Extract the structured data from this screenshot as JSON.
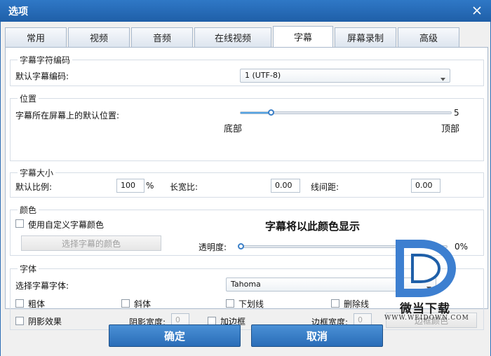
{
  "window": {
    "title": "选项"
  },
  "tabs": [
    {
      "label": "常用"
    },
    {
      "label": "视频"
    },
    {
      "label": "音频"
    },
    {
      "label": "在线视频"
    },
    {
      "label": "字幕"
    },
    {
      "label": "屏幕录制"
    },
    {
      "label": "高级"
    }
  ],
  "active_tab": "字幕",
  "encoding": {
    "title": "字幕字符编码",
    "default_label": "默认字幕编码:",
    "selected": "1 (UTF-8)"
  },
  "position": {
    "title": "位置",
    "label": "字幕所在屏幕上的默认位置:",
    "value": "5",
    "level": 0.15,
    "min_label": "底部",
    "max_label": "顶部"
  },
  "size": {
    "title": "字幕大小",
    "scale_label": "默认比例:",
    "scale_value": "100",
    "scale_unit": "%",
    "aspect_label": "长宽比:",
    "aspect_value": "0.00",
    "spacing_label": "线间距:",
    "spacing_value": "0.00"
  },
  "color": {
    "title": "颜色",
    "custom_label": "使用自定义字幕颜色",
    "choose_button": "选择字幕的颜色",
    "preview": "字幕将以此颜色显示",
    "opacity_label": "透明度:",
    "opacity_value": "0%",
    "opacity_level": 0.0
  },
  "font": {
    "title": "字体",
    "select_label": "选择字幕字体:",
    "selected_font": "Tahoma",
    "bold": "粗体",
    "italic": "斜体",
    "underline": "下划线",
    "strike": "删除线",
    "shadow": "阴影效果",
    "shadow_width_label": "阴影宽度:",
    "shadow_width_value": "0",
    "border": "加边框",
    "border_width_label": "边框宽度:",
    "border_width_value": "0",
    "border_color_button": "边框颜色"
  },
  "footer": {
    "ok": "确定",
    "cancel": "取消"
  },
  "watermark": {
    "brand": "微当下载",
    "url": "WWW.WEIDOWN.COM"
  },
  "colors": {
    "accent": "#2f78c6",
    "slider": "#52a4e6"
  }
}
